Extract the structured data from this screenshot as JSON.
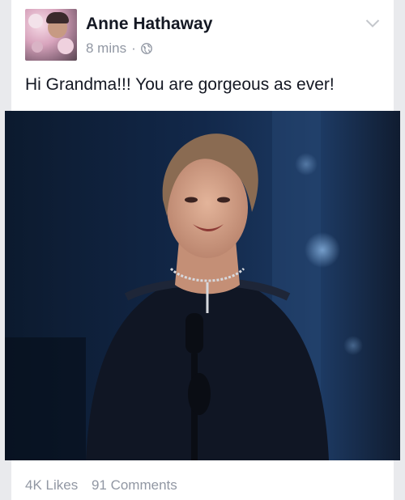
{
  "post": {
    "author": "Anne Hathaway",
    "time": "8 mins",
    "separator": "·",
    "privacy_icon": "globe-icon",
    "menu_icon": "chevron-down-icon",
    "text": "Hi Grandma!!! You are gorgeous as ever!",
    "likes": "4K Likes",
    "comments": "91 Comments"
  },
  "colors": {
    "name": "#141823",
    "meta": "#9197a3",
    "background": "#e9eaed",
    "card": "#ffffff"
  }
}
